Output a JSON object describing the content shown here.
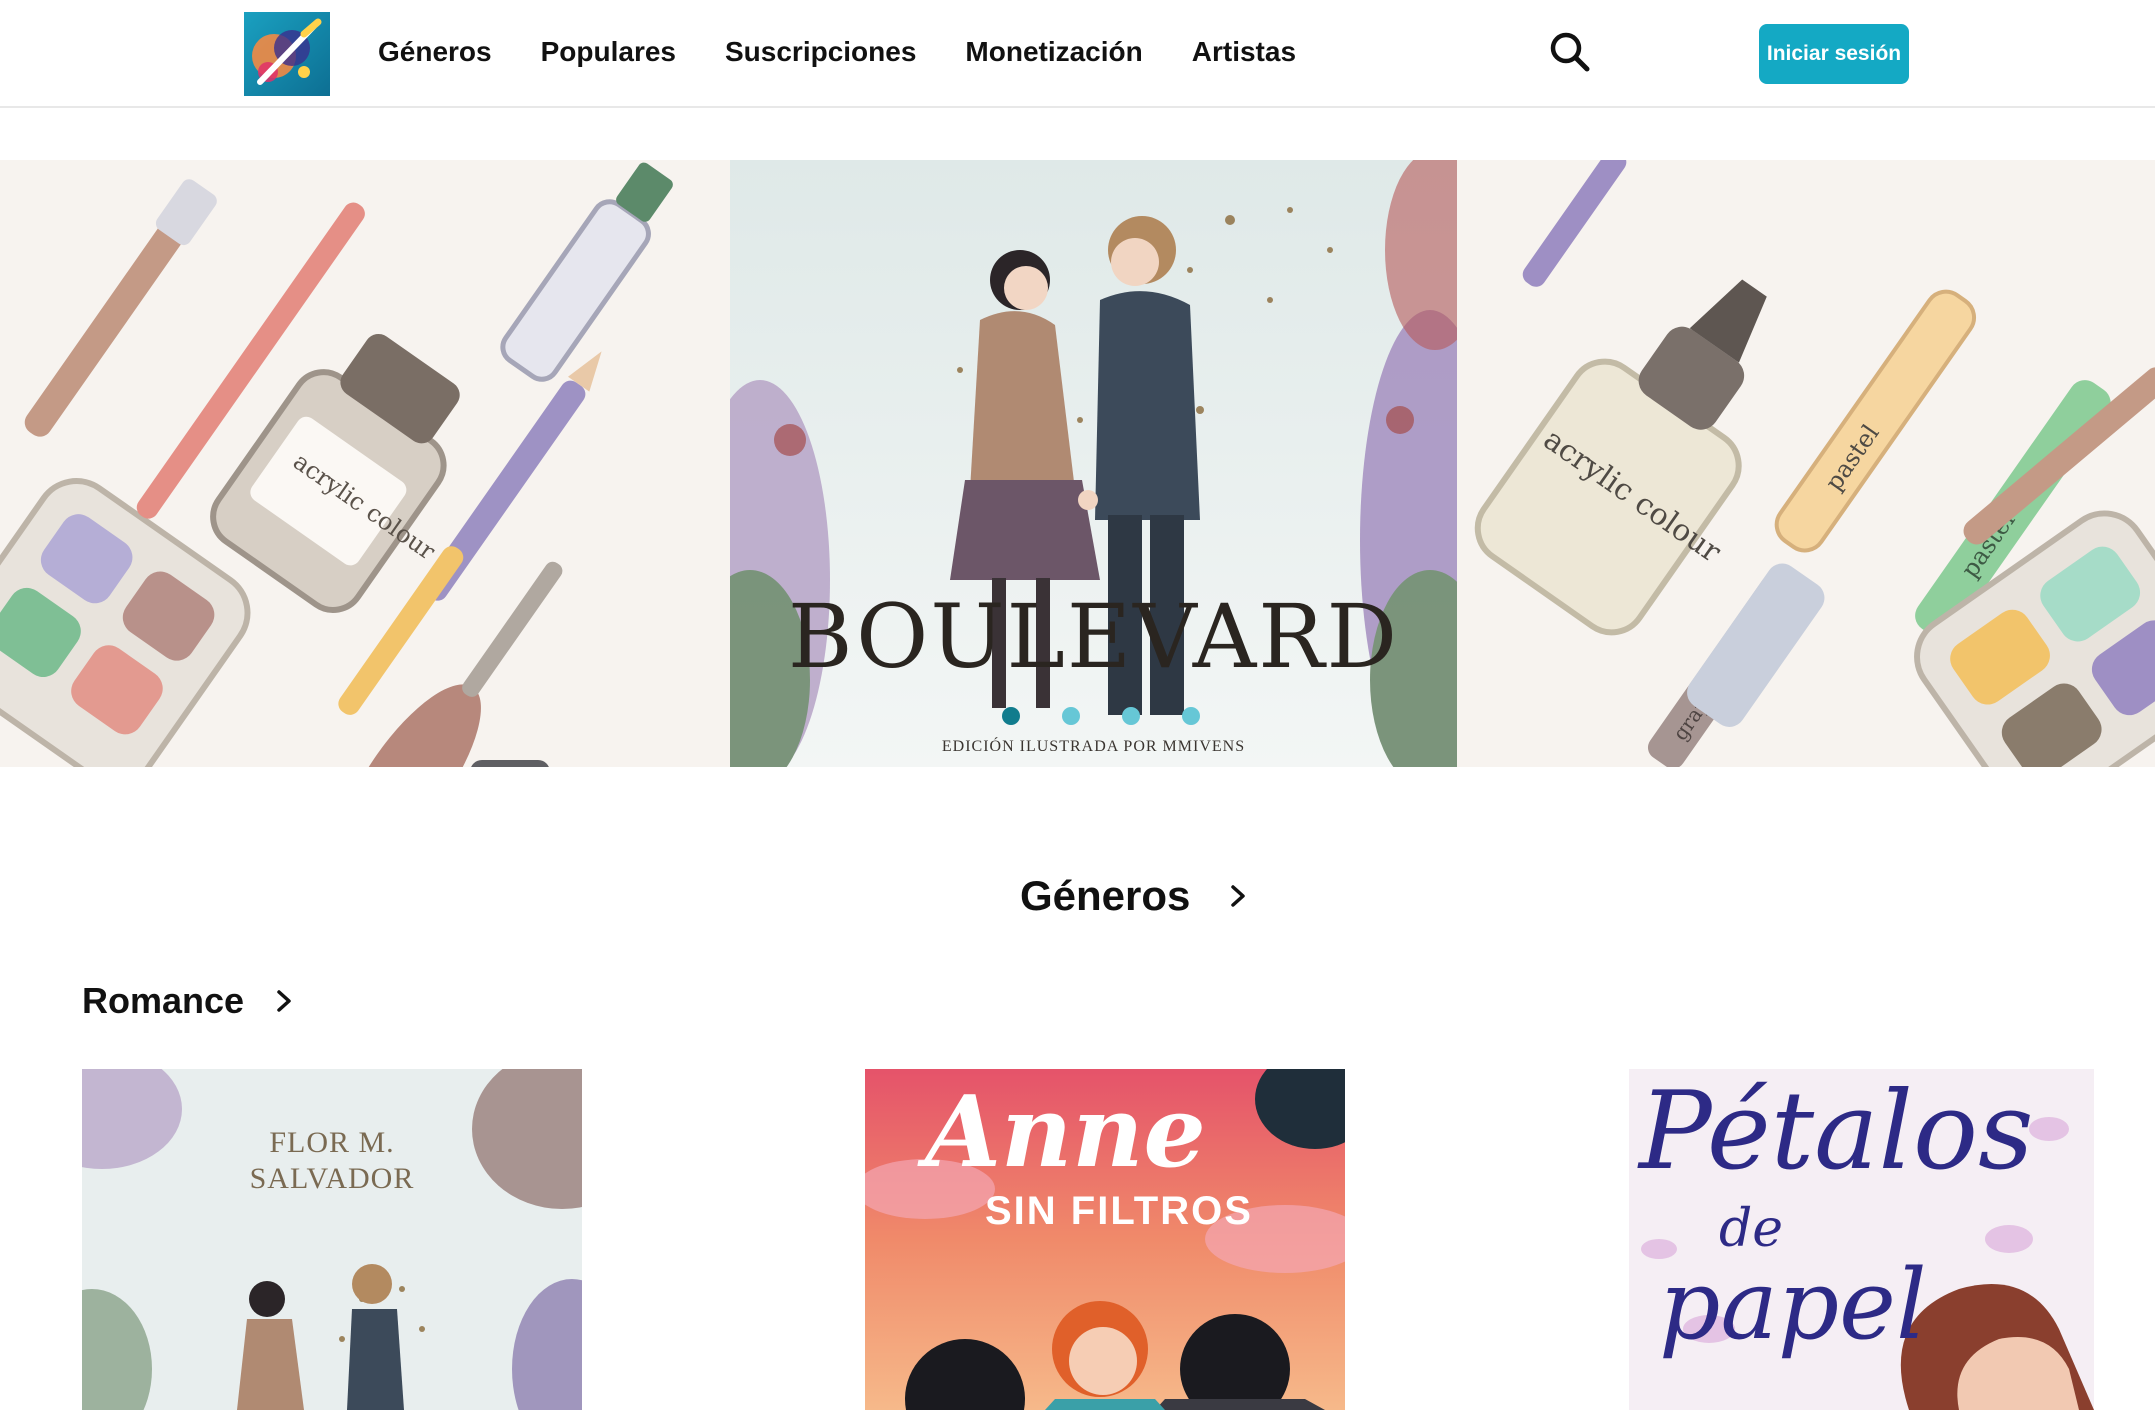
{
  "header": {
    "logo_alt": "logo",
    "nav": [
      "Géneros",
      "Populares",
      "Suscripciones",
      "Monetización",
      "Artistas"
    ],
    "login_label": "Iniciar sesión"
  },
  "hero": {
    "title": "BOULEVARD",
    "credit": "EDICIÓN ILUSTRADA POR MMIVENS",
    "left_labels": [
      "acrylic colour"
    ],
    "right_labels": [
      "acrylic colour",
      "pastel",
      "pastel",
      "graphite"
    ],
    "slides": 4,
    "active_slide": 1
  },
  "sections": {
    "genres_title": "Géneros",
    "romance_title": "Romance"
  },
  "books": [
    {
      "author_line1": "FLOR M.",
      "author_line2": "SALVADOR"
    },
    {
      "title_line1": "Anne",
      "title_line2": "SIN FILTROS"
    },
    {
      "title_line1": "Pétalos",
      "title_line2": "de",
      "title_line3": "papel"
    }
  ],
  "colors": {
    "accent": "#14a9c4",
    "dot_active": "#117c8d",
    "dot_inactive": "#66c7d6"
  },
  "icons": [
    "search-icon",
    "chevron-right-icon"
  ]
}
